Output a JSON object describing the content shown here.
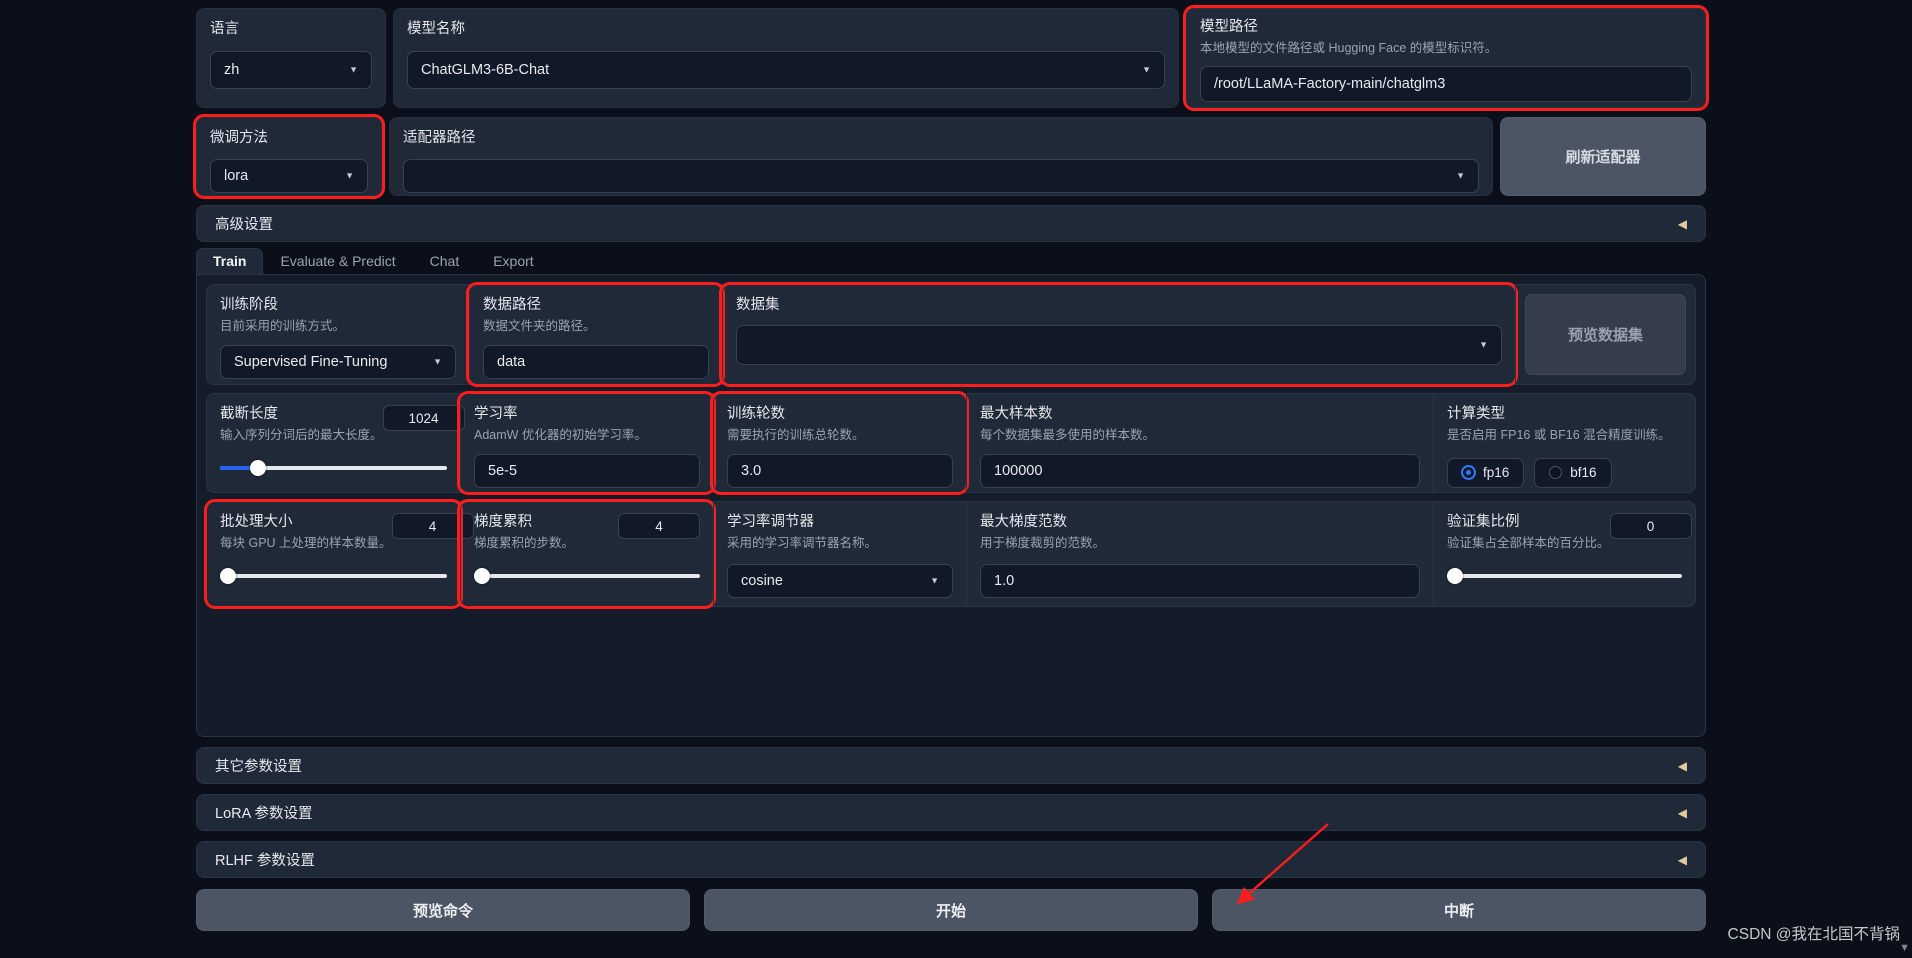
{
  "top": {
    "language": {
      "label": "语言",
      "value": "zh"
    },
    "model_name": {
      "label": "模型名称",
      "value": "ChatGLM3-6B-Chat"
    },
    "model_path": {
      "label": "模型路径",
      "info": "本地模型的文件路径或 Hugging Face 的模型标识符。",
      "value": "/root/LLaMA-Factory-main/chatglm3"
    }
  },
  "row2": {
    "finetune_method": {
      "label": "微调方法",
      "value": "lora"
    },
    "adapter_path": {
      "label": "适配器路径",
      "value": ""
    },
    "refresh_button": "刷新适配器"
  },
  "advanced": {
    "label": "高级设置",
    "arrow": "◀"
  },
  "tabs": [
    {
      "label": "Train",
      "active": true
    },
    {
      "label": "Evaluate & Predict",
      "active": false
    },
    {
      "label": "Chat",
      "active": false
    },
    {
      "label": "Export",
      "active": false
    }
  ],
  "train": {
    "stage": {
      "label": "训练阶段",
      "info": "目前采用的训练方式。",
      "value": "Supervised Fine-Tuning"
    },
    "data_path": {
      "label": "数据路径",
      "info": "数据文件夹的路径。",
      "value": "data"
    },
    "dataset": {
      "label": "数据集",
      "value": ""
    },
    "preview_button": "预览数据集",
    "cutoff_len": {
      "label": "截断长度",
      "info": "输入序列分词后的最大长度。",
      "value": "1024",
      "percent": 12
    },
    "learning_rate": {
      "label": "学习率",
      "info": "AdamW 优化器的初始学习率。",
      "value": "5e-5"
    },
    "epochs": {
      "label": "训练轮数",
      "info": "需要执行的训练总轮数。",
      "value": "3.0"
    },
    "max_samples": {
      "label": "最大样本数",
      "info": "每个数据集最多使用的样本数。",
      "value": "100000"
    },
    "compute_type": {
      "label": "计算类型",
      "info": "是否启用 FP16 或 BF16 混合精度训练。",
      "options": [
        {
          "label": "fp16",
          "selected": true
        },
        {
          "label": "bf16",
          "selected": false
        }
      ]
    },
    "batch_size": {
      "label": "批处理大小",
      "info": "每块 GPU 上处理的样本数量。",
      "value": "4",
      "percent": 1
    },
    "grad_accum": {
      "label": "梯度累积",
      "info": "梯度累积的步数。",
      "value": "4",
      "percent": 1
    },
    "lr_scheduler": {
      "label": "学习率调节器",
      "info": "采用的学习率调节器名称。",
      "value": "cosine"
    },
    "max_grad_norm": {
      "label": "最大梯度范数",
      "info": "用于梯度裁剪的范数。",
      "value": "1.0"
    },
    "val_size": {
      "label": "验证集比例",
      "info": "验证集占全部样本的百分比。",
      "value": "0",
      "percent": 0
    }
  },
  "accordions": [
    {
      "label": "其它参数设置",
      "arrow": "◀"
    },
    {
      "label": "LoRA 参数设置",
      "arrow": "◀"
    },
    {
      "label": "RLHF 参数设置",
      "arrow": "◀"
    }
  ],
  "bottom_buttons": [
    {
      "label": "预览命令"
    },
    {
      "label": "开始"
    },
    {
      "label": "中断"
    }
  ],
  "watermark": "CSDN @我在北国不背锅",
  "colors": {
    "highlight": "#fc1d1d",
    "accent": "#2563eb",
    "radio_selected": "#2f7bf6",
    "panel": "#1f2937",
    "background": "#0b0f19"
  }
}
